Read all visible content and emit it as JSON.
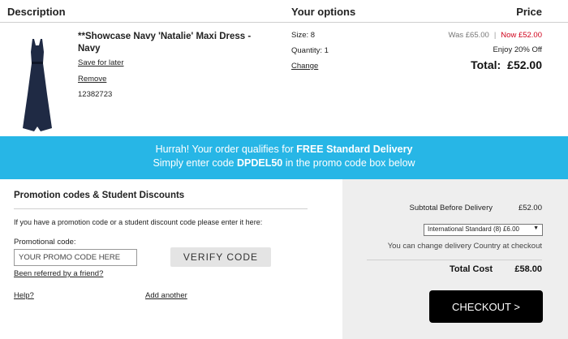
{
  "header": {
    "description": "Description",
    "options": "Your options",
    "price": "Price"
  },
  "product": {
    "title": "**Showcase Navy 'Natalie' Maxi Dress - Navy",
    "save_for_later": "Save for later",
    "remove": "Remove",
    "sku": "12382723",
    "size": "Size: 8",
    "quantity": "Quantity: 1",
    "change": "Change",
    "was_price": "Was £65.00",
    "separator": "|",
    "now_price": "Now £52.00",
    "discount": "Enjoy 20% Off",
    "total_label": "Total:",
    "total_value": "£52.00",
    "image_color": "#1f2a44"
  },
  "banner": {
    "line1_prefix": "Hurrah! Your order qualifies for ",
    "line1_bold": "FREE Standard Delivery",
    "line2_prefix": "Simply enter code ",
    "line2_bold": "DPDEL50",
    "line2_suffix": " in the promo code box below",
    "color": "#27b6e6"
  },
  "promo": {
    "title": "Promotion codes & Student Discounts",
    "description": "If you have a promotion code or a student discount code please enter it here:",
    "label": "Promotional code:",
    "placeholder": "YOUR PROMO CODE HERE",
    "verify_label": "VERIFY CODE",
    "referred": "Been referred by a friend?",
    "help": "Help?",
    "add_another": "Add another"
  },
  "summary": {
    "subtotal_label": "Subtotal Before Delivery",
    "subtotal_value": "£52.00",
    "delivery_option": "International Standard (8) £6.00",
    "change_country": "You can change delivery Country at checkout",
    "total_label": "Total Cost",
    "total_value": "£58.00",
    "checkout_label": "CHECKOUT >"
  }
}
